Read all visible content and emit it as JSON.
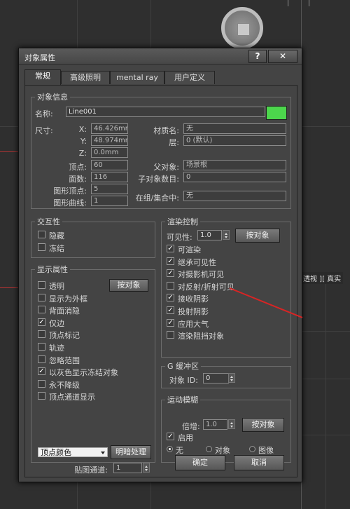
{
  "viewport": {
    "label": "透视 ][ 真实",
    "top_fragments": [
      "|",
      "|"
    ]
  },
  "dialog": {
    "title": "对象属性",
    "help_label": "?",
    "close_label": "✕",
    "tabs": [
      "常规",
      "高级照明",
      "mental ray",
      "用户定义"
    ],
    "object_info": {
      "legend": "对象信息",
      "name_label": "名称:",
      "name_value": "Line001",
      "swatch_color": "#4cd64c",
      "dims_label": "尺寸:",
      "x_label": "X:",
      "x_value": "46.426mm",
      "y_label": "Y:",
      "y_value": "48.974mm",
      "z_label": "Z:",
      "z_value": "0.0mm",
      "vertices_label": "顶点:",
      "vertices_value": "60",
      "faces_label": "面数:",
      "faces_value": "116",
      "shape_vertices_label": "图形顶点:",
      "shape_vertices_value": "5",
      "shape_curves_label": "图形曲线:",
      "shape_curves_value": "1",
      "material_label": "材质名:",
      "material_value": "无",
      "layer_label": "层:",
      "layer_value": "0 (默认)",
      "parent_label": "父对象:",
      "parent_value": "场景根",
      "children_label": "子对象数目:",
      "children_value": "0",
      "group_label": "在组/集合中:",
      "group_value": "无"
    },
    "interactivity": {
      "legend": "交互性",
      "hide": "隐藏",
      "freeze": "冻结"
    },
    "display": {
      "legend": "显示属性",
      "by_object_label": "按对象",
      "items": [
        {
          "label": "透明",
          "checked": false
        },
        {
          "label": "显示为外框",
          "checked": false
        },
        {
          "label": "背面消隐",
          "checked": false
        },
        {
          "label": "仅边",
          "checked": true
        },
        {
          "label": "顶点标记",
          "checked": false
        },
        {
          "label": "轨迹",
          "checked": false
        },
        {
          "label": "忽略范围",
          "checked": false
        },
        {
          "label": "以灰色显示冻结对象",
          "checked": true
        },
        {
          "label": "永不降级",
          "checked": false
        },
        {
          "label": "顶点通道显示",
          "checked": false
        }
      ],
      "vertex_color_value": "顶点颜色",
      "shading_button": "明暗处理",
      "map_channel_label": "贴图通道:",
      "map_channel_value": "1"
    },
    "render": {
      "legend": "渲染控制",
      "visibility_label": "可见性:",
      "visibility_value": "1.0",
      "by_object_label": "按对象",
      "items": [
        {
          "label": "可渲染",
          "checked": true
        },
        {
          "label": "继承可见性",
          "checked": true
        },
        {
          "label": "对摄影机可见",
          "checked": true
        },
        {
          "label": "对反射/折射可见",
          "checked": false
        },
        {
          "label": "接收阴影",
          "checked": true
        },
        {
          "label": "投射阴影",
          "checked": true
        },
        {
          "label": "应用大气",
          "checked": true
        },
        {
          "label": "渲染阻挡对象",
          "checked": false
        }
      ]
    },
    "gbuffer": {
      "legend": "G 缓冲区",
      "object_id_label": "对象 ID:",
      "object_id_value": "0"
    },
    "motion_blur": {
      "legend": "运动模糊",
      "multiplier_label": "倍增:",
      "multiplier_value": "1.0",
      "by_object_label": "按对象",
      "enable_label": "启用",
      "enable_checked": true,
      "none_label": "无",
      "object_label": "对象",
      "image_label": "图像"
    },
    "ok_label": "确定",
    "cancel_label": "取消"
  }
}
